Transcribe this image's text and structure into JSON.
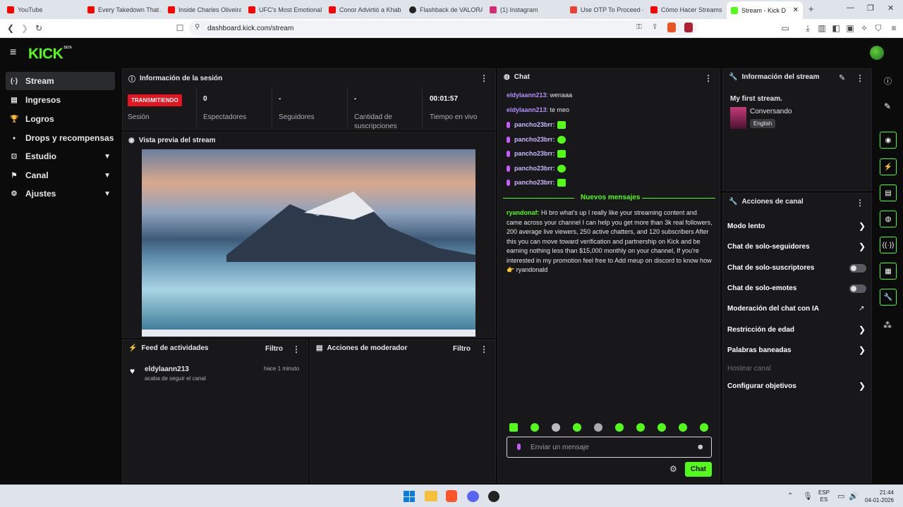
{
  "browser": {
    "tabs": [
      {
        "label": "YouTube",
        "color": "#ff0000"
      },
      {
        "label": "Every Takedown That A",
        "color": "#ff0000"
      },
      {
        "label": "Inside Charles Oliveira",
        "color": "#ff0000"
      },
      {
        "label": "UFC's Most Emotional",
        "color": "#ff0000"
      },
      {
        "label": "Conor Advirtió a Khab",
        "color": "#ff0000"
      },
      {
        "label": "Flashback de VALORAI",
        "color": "#222222"
      },
      {
        "label": "(1) Instagram",
        "color": "#d62976"
      },
      {
        "label": "Use OTP To Proceed -",
        "color": "#ea4335"
      },
      {
        "label": "Cómo Hacer Streams",
        "color": "#ff0000"
      },
      {
        "label": "Stream - Kick D",
        "color": "#53fc18"
      }
    ],
    "url": "dashboard.kick.com/stream"
  },
  "header": {
    "logo": "KICK",
    "beta": "BETA"
  },
  "sidebar": {
    "items": [
      {
        "label": "Stream",
        "icon": "(·)"
      },
      {
        "label": "Ingresos",
        "icon": "▤"
      },
      {
        "label": "Logros",
        "icon": "🏆"
      },
      {
        "label": "Drops y recompensas",
        "icon": "⬩"
      },
      {
        "label": "Estudio",
        "icon": "⊡"
      },
      {
        "label": "Canal",
        "icon": "⚑"
      },
      {
        "label": "Ajustes",
        "icon": "⚙"
      }
    ]
  },
  "session": {
    "title": "Información de la sesión",
    "badge": "TRANSMITIENDO",
    "badge_label": "Sesión",
    "stats": [
      {
        "value": "0",
        "label": "Espectadores"
      },
      {
        "value": "-",
        "label": "Seguidores"
      },
      {
        "value": "-",
        "label": "Cantidad de suscripciones"
      },
      {
        "value": "00:01:57",
        "label": "Tiempo en vivo"
      }
    ]
  },
  "preview": {
    "title": "Vista previa del stream"
  },
  "feed": {
    "title": "Feed de actividades",
    "filter": "Filtro",
    "user": "eldylaann213",
    "time": "hace 1 minuto",
    "text": "acaba de seguir el canal"
  },
  "mod": {
    "title": "Acciones de moderador",
    "filter": "Filtro"
  },
  "chat": {
    "title": "Chat",
    "lines": [
      {
        "user": "eldylaann213",
        "text": "wenaaa"
      },
      {
        "user": "eldylaann213",
        "text": "te meo"
      },
      {
        "user": "pancho23brr:",
        "text": ""
      },
      {
        "user": "pancho23brr:",
        "text": ""
      },
      {
        "user": "pancho23brr:",
        "text": ""
      },
      {
        "user": "pancho23brr:",
        "text": ""
      },
      {
        "user": "pancho23brr:",
        "text": ""
      }
    ],
    "new_messages": "Nuevos mensajes",
    "promo_user": "ryandonaf:",
    "promo_text": "Hi bro what's up I really like your streaming content and came across your channel I can help you get more than 3k real followers, 200 average live viewers, 250 active chatters, and 120 subscribers After this you can move toward verification and partnership on Kick and be earning nothing less than $15,000 monthly on your channel, If you're interested in my promotion feel free to Add meup on discord to know how👉 ryandonald",
    "placeholder": "Enviar un mensaje",
    "send": "Chat"
  },
  "stream_info": {
    "title": "Información del stream",
    "stream_title": "My first stream.",
    "category": "Conversando",
    "language": "English"
  },
  "channel_actions": {
    "title": "Acciones de canal",
    "items": [
      {
        "label": "Modo lento"
      },
      {
        "label": "Chat de solo-seguidores"
      },
      {
        "label": "Chat de solo-suscriptores"
      },
      {
        "label": "Chat de solo-emotes"
      },
      {
        "label": "Moderación del chat con IA"
      },
      {
        "label": "Restricción de edad"
      },
      {
        "label": "Palabras baneadas"
      },
      {
        "label": "Hostear canal"
      },
      {
        "label": "Configurar objetivos"
      }
    ]
  },
  "taskbar": {
    "lang1": "ESP",
    "lang2": "ES",
    "time": "21:44",
    "date": "04-01-2026"
  }
}
